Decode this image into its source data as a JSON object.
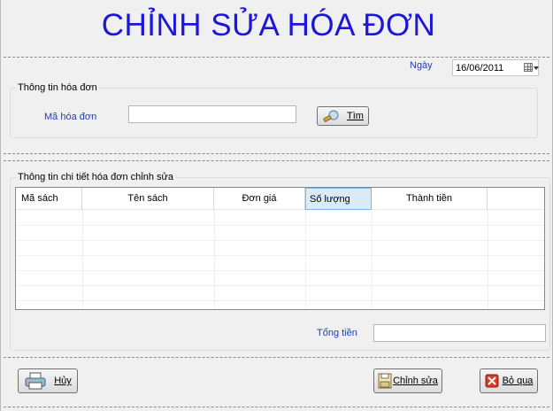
{
  "form": {
    "title": "CHỈNH SỬA HÓA ĐƠN",
    "date_label": "Ngày",
    "date_value": "16/06/2011"
  },
  "invoice_info": {
    "group_title": "Thông tin hóa đơn",
    "invoice_code_label": "Mã hóa đơn",
    "invoice_code_value": "",
    "search_button": "Tìm"
  },
  "details": {
    "group_title": "Thông tin chi tiết hóa đơn chỉnh sửa",
    "columns": [
      "Mã sách",
      "Tên sách",
      "Đơn giá",
      "Số lượng",
      "Thành tiền"
    ],
    "selected_column": "Số lượng",
    "total_label": "Tổng tiền",
    "total_value": ""
  },
  "buttons": {
    "cancel": "Hủy",
    "edit": "Chỉnh sửa",
    "skip": "Bỏ qua"
  },
  "colors": {
    "title": "#1c16d6",
    "label": "#1c3fb8",
    "selected_header": "#d9ebf9"
  }
}
